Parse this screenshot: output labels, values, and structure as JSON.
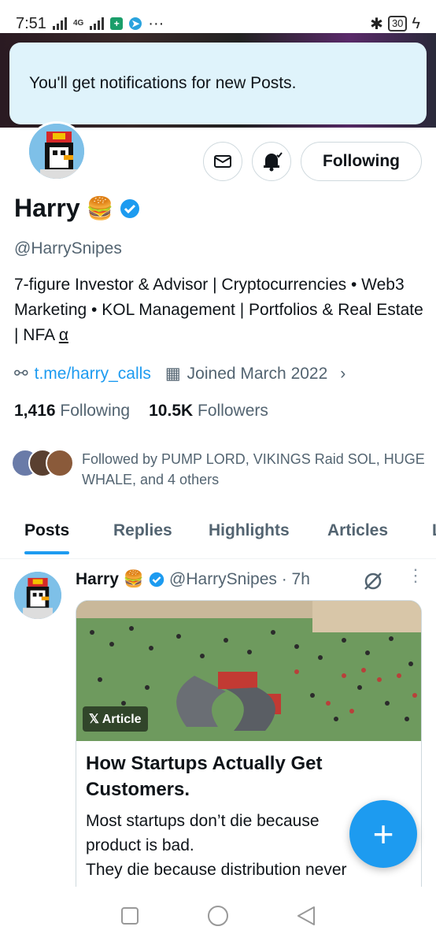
{
  "status_bar": {
    "time": "7:51",
    "net": "4G",
    "battery": "30"
  },
  "toast": {
    "message": "You'll get notifications for new Posts."
  },
  "profile": {
    "name": "Harry",
    "handle": "@HarrySnipes",
    "bio": "7-figure Investor & Advisor | Cryptocurrencies • Web3 Marketing • KOL Management | Portfolios & Real Estate | NFA",
    "bio_alpha": "α",
    "link": "t.me/harry_calls",
    "joined": "Joined March 2022",
    "following_count": "1,416",
    "following_label": "Following",
    "followers_count": "10.5K",
    "followers_label": "Followers",
    "followed_by": "Followed by PUMP LORD, VIKINGS Raid SOL, HUGE WHALE, and 4 others"
  },
  "actions": {
    "follow_label": "Following"
  },
  "tabs": [
    "Posts",
    "Replies",
    "Highlights",
    "Articles",
    "L"
  ],
  "post": {
    "name": "Harry",
    "handle_time": "@HarrySnipes · 7h",
    "badge": "Article",
    "title": "How Startups Actually Get Customers.",
    "body_1": "Most startups don’t die because",
    "body_2": "product is bad.",
    "body_3": "They die because distribution never"
  },
  "colors": {
    "accent": "#1d9bf0",
    "text": "#0f1419",
    "muted": "#536471"
  }
}
